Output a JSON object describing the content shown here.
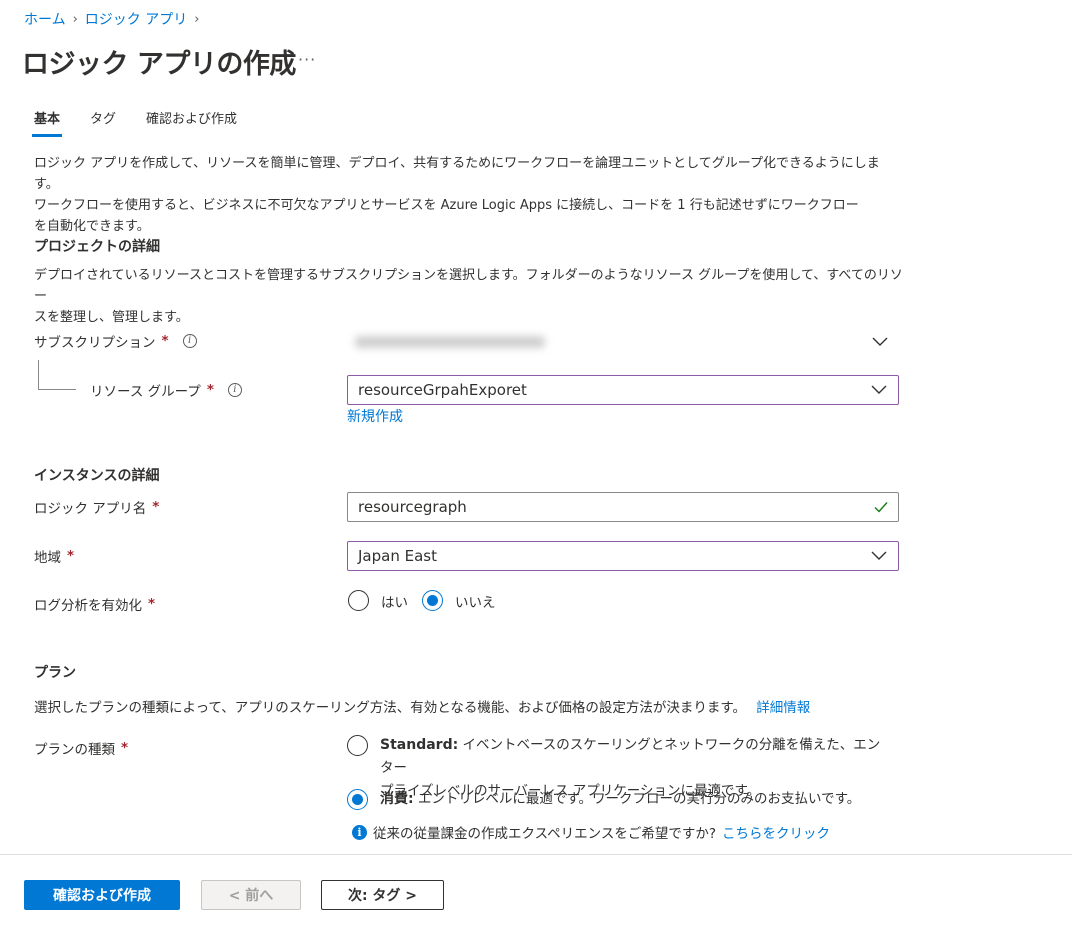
{
  "breadcrumb": [
    {
      "label": "ホーム"
    },
    {
      "label": "ロジック アプリ"
    }
  ],
  "page": {
    "title": "ロジック アプリの作成",
    "more": "···"
  },
  "tabs": [
    {
      "label": "基本",
      "active": true
    },
    {
      "label": "タグ",
      "active": false
    },
    {
      "label": "確認および作成",
      "active": false
    }
  ],
  "intro": {
    "line1": "ロジック アプリを作成して、リソースを簡単に管理、デプロイ、共有するためにワークフローを論理ユニットとしてグループ化できるようにします。",
    "line2": "ワークフローを使用すると、ビジネスに不可欠なアプリとサービスを Azure Logic Apps に接続し、コードを 1 行も記述せずにワークフロー",
    "line3": "を自動化できます。"
  },
  "project": {
    "title": "プロジェクトの詳細",
    "desc_line1": "デプロイされているリソースとコストを管理するサブスクリプションを選択します。フォルダーのようなリソース グループを使用して、すべてのリソー",
    "desc_line2": "スを整理し、管理します。",
    "subscription_label": "サブスクリプション",
    "subscription_value": "",
    "resource_group_label": "リソース グループ",
    "resource_group_value": "resourceGrpahExporet",
    "create_new_link": "新規作成"
  },
  "instance": {
    "title": "インスタンスの詳細",
    "name_label": "ロジック アプリ名",
    "name_value": "resourcegraph",
    "region_label": "地域",
    "region_value": "Japan East",
    "log_label": "ログ分析を有効化",
    "log_yes": "はい",
    "log_no": "いいえ",
    "log_selected": "いいえ"
  },
  "plan": {
    "title": "プラン",
    "desc": "選択したプランの種類によって、アプリのスケーリング方法、有効となる機能、および価格の設定方法が決まります。",
    "desc_link": "詳細情報",
    "type_label": "プランの種類",
    "standard_name": "Standard:",
    "standard_desc_line1": "イベントベースのスケーリングとネットワークの分離を備えた、エンター",
    "standard_desc_line2": "プライズレベルのサーバーレス アプリケーションに最適です。",
    "consumption_name": "消費:",
    "consumption_desc": "エントリレベルに最適です。ワークフローの実行分のみのお支払いです。",
    "selected": "消費",
    "hint_text": "従来の従量課金の作成エクスペリエンスをご希望ですか?",
    "hint_link": "こちらをクリック"
  },
  "required_mark": "*",
  "footer": {
    "review_create": "確認および作成",
    "prev": "< 前へ",
    "next": "次: タグ >"
  },
  "colors": {
    "accent": "#0078d4",
    "required": "#a4262c",
    "selected_border": "#8a5aa5",
    "valid_check": "#107c10"
  }
}
